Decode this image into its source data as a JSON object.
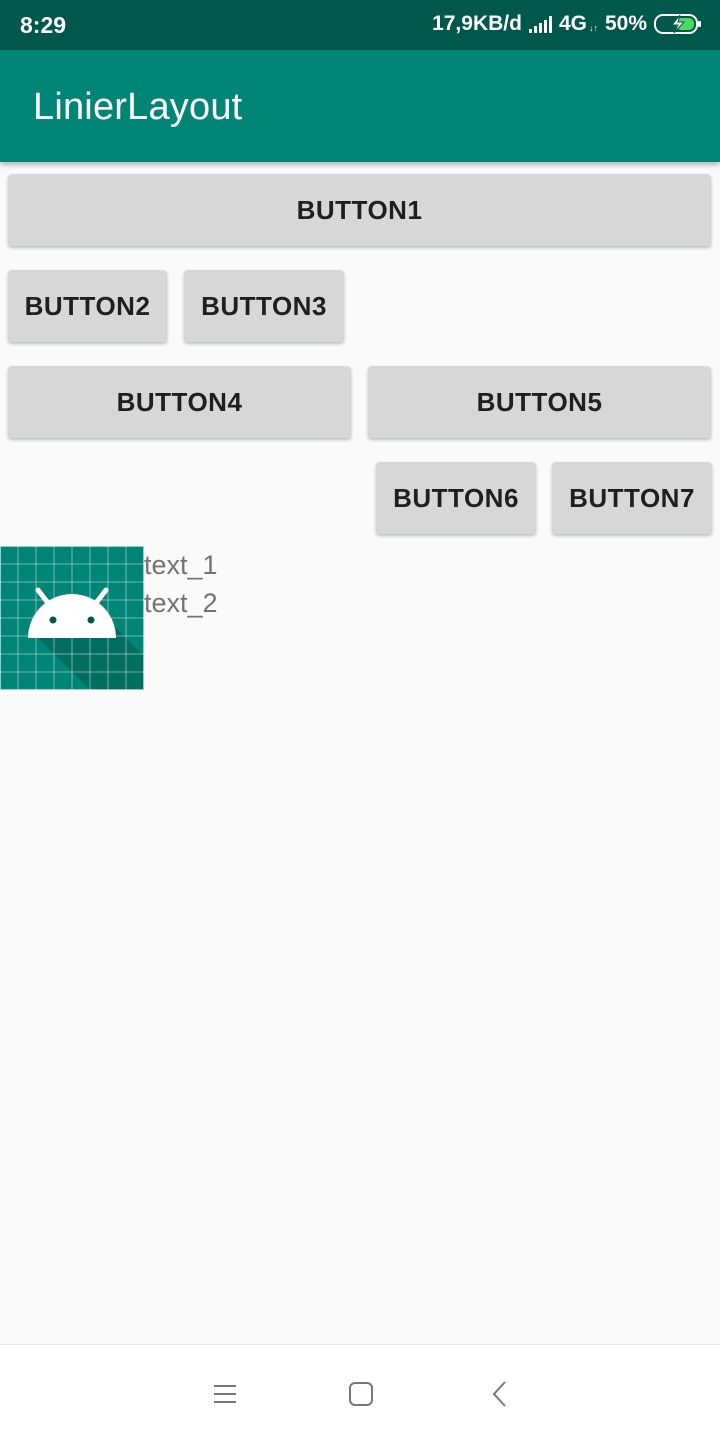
{
  "status_bar": {
    "time": "8:29",
    "net_speed": "17,9KB/d",
    "network": "4G",
    "network_sub": "↓↑",
    "battery": "50%"
  },
  "app_bar": {
    "title": "LinierLayout"
  },
  "buttons": {
    "b1": "BUTTON1",
    "b2": "BUTTON2",
    "b3": "BUTTON3",
    "b4": "BUTTON4",
    "b5": "BUTTON5",
    "b6": "BUTTON6",
    "b7": "BUTTON7"
  },
  "image": {
    "icon": "android-icon"
  },
  "texts": {
    "t1": "text_1",
    "t2": "text_2"
  },
  "nav_bar": {
    "icons": [
      "menu-icon",
      "home-icon",
      "back-icon"
    ]
  },
  "colors": {
    "status_bar": "#00574b",
    "app_bar": "#008577",
    "button": "#d6d7d7",
    "background": "#fafafa"
  }
}
